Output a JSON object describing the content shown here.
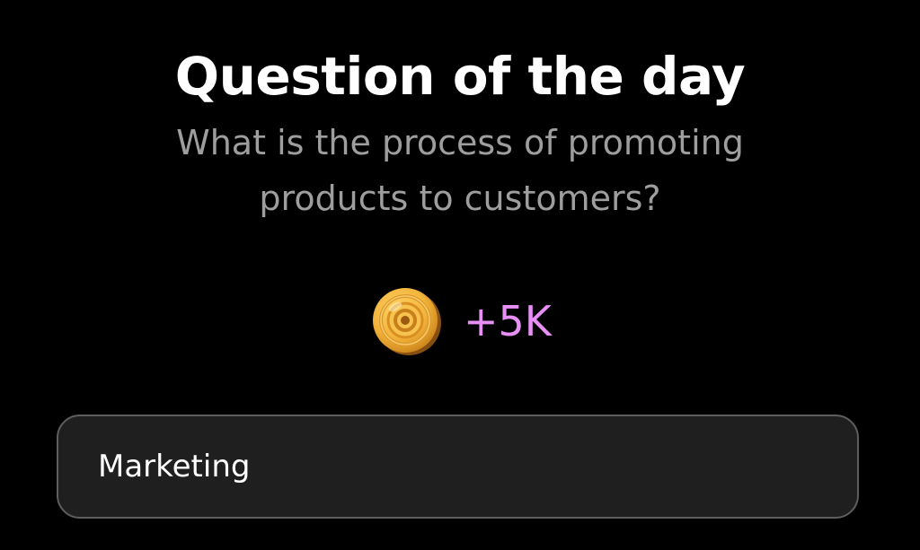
{
  "header": {
    "title": "Question of the day"
  },
  "question": {
    "text": "What is the process of promoting products to customers?"
  },
  "reward": {
    "icon": "coin-icon",
    "amount": "+5K",
    "color": "#e88ff5"
  },
  "answer": {
    "value": "Marketing"
  }
}
